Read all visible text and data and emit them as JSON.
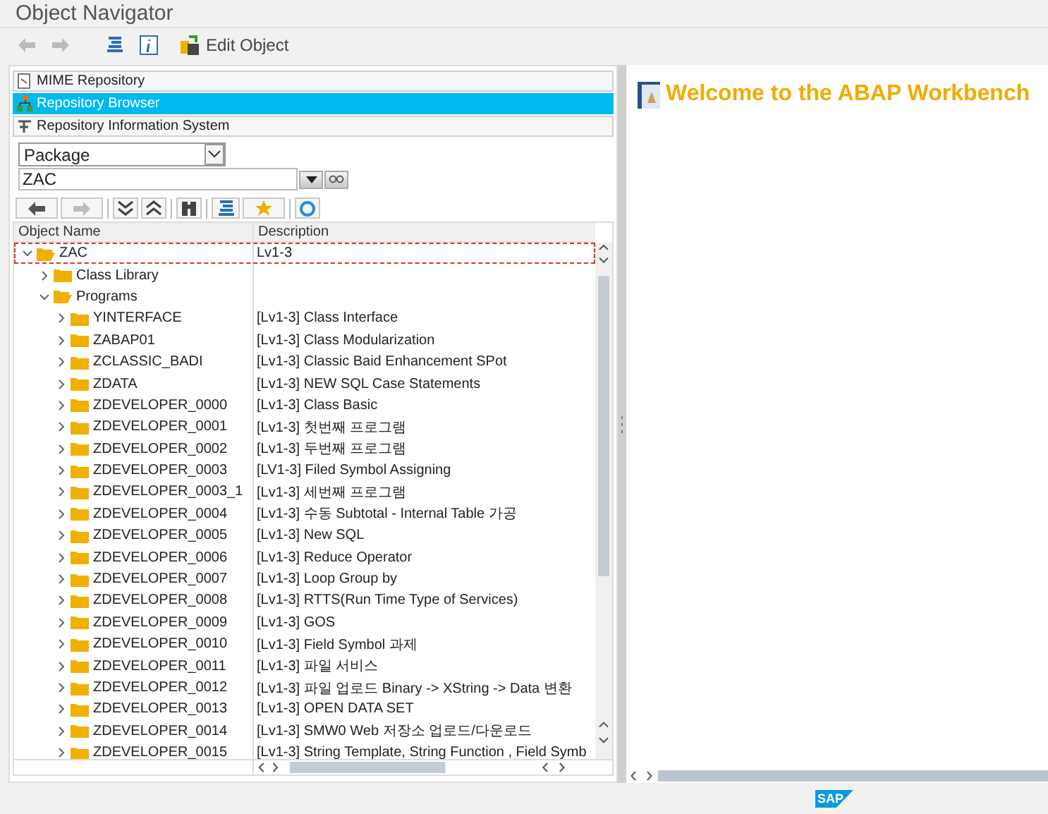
{
  "window": {
    "title": "Object Navigator"
  },
  "toolbar": {
    "buttons": [
      {
        "kind": "back",
        "disabled": true
      },
      {
        "kind": "forward",
        "disabled": true
      },
      {
        "kind": "hierarchy",
        "disabled": false
      },
      {
        "kind": "info",
        "disabled": false
      }
    ],
    "edit_object": {
      "label": "Edit Object"
    }
  },
  "navigator_tabs": [
    {
      "kind": "mime",
      "label": "MIME Repository",
      "selected": false
    },
    {
      "kind": "browser",
      "label": "Repository Browser",
      "selected": true
    },
    {
      "kind": "info_system",
      "label": "Repository Information System",
      "selected": false
    }
  ],
  "object_type": {
    "value": "Package"
  },
  "object_name": {
    "value": "ZAC"
  },
  "tree_toolbar": {
    "buttons": [
      {
        "kind": "back",
        "disabled": false
      },
      {
        "kind": "forward",
        "disabled": true
      },
      {
        "kind": "expand_all",
        "disabled": false
      },
      {
        "kind": "collapse_all",
        "disabled": false
      },
      {
        "kind": "find",
        "disabled": false
      },
      {
        "kind": "hierarchy",
        "disabled": false
      },
      {
        "kind": "favorite",
        "disabled": false
      },
      {
        "kind": "refresh",
        "disabled": false
      }
    ]
  },
  "tree": {
    "columns": [
      "Object Name",
      "Description"
    ],
    "rows": [
      {
        "name": "ZAC",
        "description": "Lv1-3",
        "expanded": true,
        "selected": true,
        "children": [
          {
            "name": "Class Library",
            "expanded": false,
            "selected": false
          },
          {
            "name": "Programs",
            "expanded": true,
            "selected": false,
            "children": [
              {
                "name": "YINTERFACE",
                "description": "[Lv1-3] Class Interface",
                "expanded": false,
                "selected": false
              },
              {
                "name": "ZABAP01",
                "description": "[Lv1-3] Class Modularization",
                "expanded": false,
                "selected": false
              },
              {
                "name": "ZCLASSIC_BADI",
                "description": "[Lv1-3] Classic Baid Enhancement SPot",
                "expanded": false,
                "selected": false
              },
              {
                "name": "ZDATA",
                "description": "[Lv1-3] NEW SQL Case Statements",
                "expanded": false,
                "selected": false
              },
              {
                "name": "ZDEVELOPER_0000",
                "description": "[Lv1-3] Class Basic",
                "expanded": false,
                "selected": false
              },
              {
                "name": "ZDEVELOPER_0001",
                "description": "[Lv1-3] 첫번째 프로그램",
                "expanded": false,
                "selected": false
              },
              {
                "name": "ZDEVELOPER_0002",
                "description": "[Lv1-3] 두번째 프로그램",
                "expanded": false,
                "selected": false
              },
              {
                "name": "ZDEVELOPER_0003",
                "description": "[LV1-3] Filed Symbol Assigning",
                "expanded": false,
                "selected": false
              },
              {
                "name": "ZDEVELOPER_0003_1",
                "description": "[Lv1-3] 세번째 프로그램",
                "expanded": false,
                "selected": false
              },
              {
                "name": "ZDEVELOPER_0004",
                "description": "[Lv1-3] 수동 Subtotal - Internal Table 가공",
                "expanded": false,
                "selected": false
              },
              {
                "name": "ZDEVELOPER_0005",
                "description": "[Lv1-3] New SQL",
                "expanded": false,
                "selected": false
              },
              {
                "name": "ZDEVELOPER_0006",
                "description": "[Lv1-3] Reduce Operator",
                "expanded": false,
                "selected": false
              },
              {
                "name": "ZDEVELOPER_0007",
                "description": "[Lv1-3] Loop Group by",
                "expanded": false,
                "selected": false
              },
              {
                "name": "ZDEVELOPER_0008",
                "description": "[Lv1-3] RTTS(Run Time Type of Services)",
                "expanded": false,
                "selected": false
              },
              {
                "name": "ZDEVELOPER_0009",
                "description": "[Lv1-3] GOS",
                "expanded": false,
                "selected": false
              },
              {
                "name": "ZDEVELOPER_0010",
                "description": "[Lv1-3] Field Symbol 과제",
                "expanded": false,
                "selected": false
              },
              {
                "name": "ZDEVELOPER_0011",
                "description": "[Lv1-3] 파일 서비스",
                "expanded": false,
                "selected": false
              },
              {
                "name": "ZDEVELOPER_0012",
                "description": "[Lv1-3] 파일 업로드 Binary -> XString -> Data 변환",
                "expanded": false,
                "selected": false
              },
              {
                "name": "ZDEVELOPER_0013",
                "description": "[Lv1-3] OPEN DATA SET",
                "expanded": false,
                "selected": false
              },
              {
                "name": "ZDEVELOPER_0014",
                "description": "[Lv1-3] SMW0 Web 저장소 업로드/다운로드",
                "expanded": false,
                "selected": false
              },
              {
                "name": "ZDEVELOPER_0015",
                "description": "[Lv1-3] String Template, String Function , Field Symb",
                "expanded": false,
                "selected": false
              }
            ]
          }
        ]
      }
    ]
  },
  "welcome": {
    "title": "Welcome to the ABAP Workbench"
  },
  "footer": {
    "logo": "SAP"
  }
}
